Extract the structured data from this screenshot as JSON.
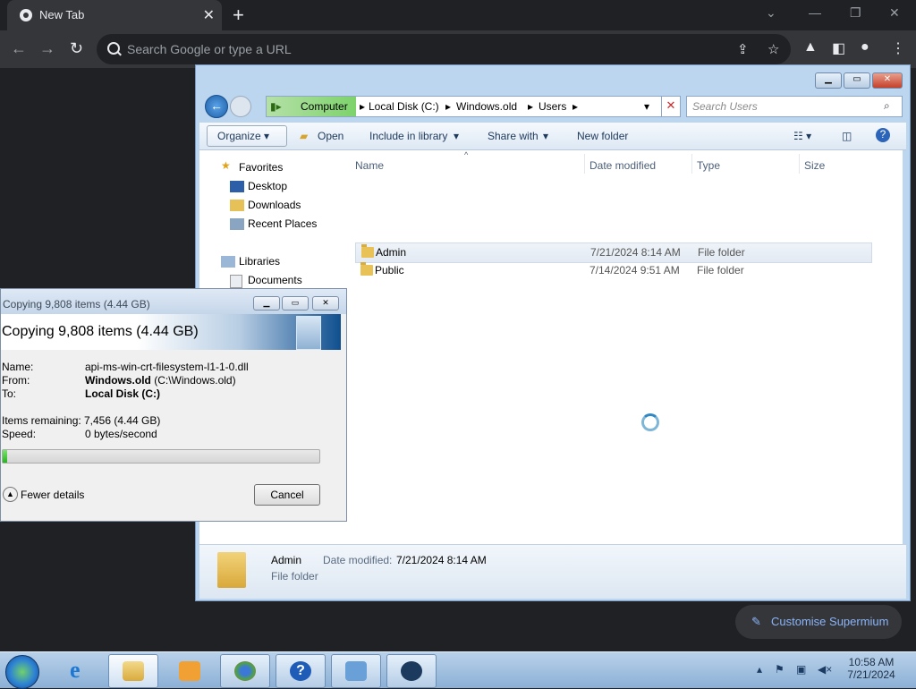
{
  "chrome": {
    "tab_title": "New Tab",
    "omnibox_placeholder": "Search Google or type a URL",
    "customise_label": "Customise Supermium"
  },
  "explorer": {
    "breadcrumbs": [
      "Computer",
      "Local Disk (C:)",
      "Windows.old",
      "Users"
    ],
    "search_placeholder": "Search Users",
    "commands": {
      "organize": "Organize",
      "open": "Open",
      "include": "Include in library",
      "share": "Share with",
      "new_folder": "New folder"
    },
    "nav": {
      "favorites": "Favorites",
      "desktop": "Desktop",
      "downloads": "Downloads",
      "recent": "Recent Places",
      "libraries": "Libraries",
      "documents": "Documents"
    },
    "columns": [
      "Name",
      "Date modified",
      "Type",
      "Size"
    ],
    "rows": [
      {
        "name": "Admin",
        "date": "7/21/2024 8:14 AM",
        "type": "File folder",
        "selected": true
      },
      {
        "name": "Public",
        "date": "7/14/2024 9:51 AM",
        "type": "File folder",
        "selected": false
      }
    ],
    "details": {
      "name": "Admin",
      "date_label": "Date modified:",
      "date": "7/21/2024 8:14 AM",
      "type": "File folder"
    }
  },
  "copy_dialog": {
    "window_title": "Copying 9,808 items (4.44 GB)",
    "heading": "Copying 9,808 items (4.44 GB)",
    "name_label": "Name:",
    "name_value": "api-ms-win-crt-filesystem-l1-1-0.dll",
    "from_label": "From:",
    "from_bold": "Windows.old",
    "from_rest": " (C:\\Windows.old)",
    "to_label": "To:",
    "to_value": "Local Disk (C:)",
    "remaining_label": "Items remaining:",
    "remaining_value": "7,456 (4.44 GB)",
    "speed_label": "Speed:",
    "speed_value": "0 bytes/second",
    "progress_fraction": 0.015,
    "fewer_details": "Fewer details",
    "cancel": "Cancel"
  },
  "taskbar": {
    "time": "10:58 AM",
    "date": "7/21/2024"
  }
}
